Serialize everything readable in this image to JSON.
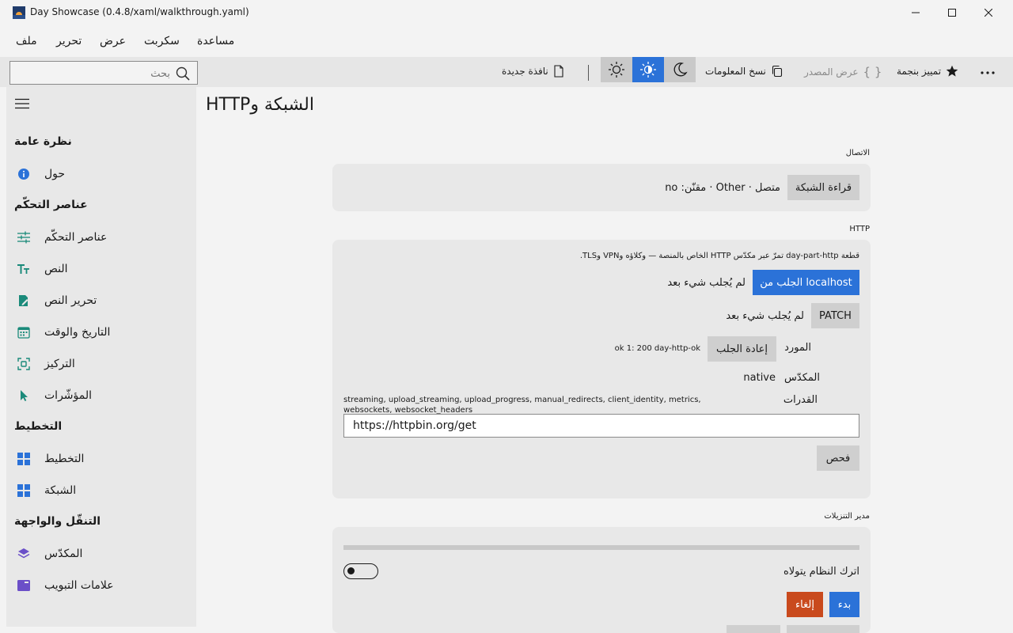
{
  "window": {
    "title": "Day Showcase (0.4.8/xaml/walkthrough.yaml)"
  },
  "menu": {
    "items": [
      "ملف",
      "تحرير",
      "عرض",
      "سكربت",
      "مساعدة"
    ]
  },
  "toolbar": {
    "search_placeholder": "بحث",
    "new_window": "نافذة جديدة",
    "copy_info": "نسخ المعلومات",
    "view_source": "عرض المصدر",
    "star": "تمييز بنجمة"
  },
  "sidebar": {
    "sections": [
      {
        "title": "نظرة عامة",
        "items": [
          "حول"
        ]
      },
      {
        "title": "عناصر التحكّم",
        "items": [
          "عناصر التحكّم",
          "النص",
          "تحرير النص",
          "التاريخ والوقت",
          "التركيز",
          "المؤشّرات"
        ]
      },
      {
        "title": "التخطيط",
        "items": [
          "التخطيط",
          "الشبكة"
        ]
      },
      {
        "title": "التنقّل والواجهة",
        "items": [
          "المكدّس",
          "علامات التبويب"
        ]
      }
    ]
  },
  "page": {
    "title": "الشبكة وHTTP",
    "connection": {
      "label": "الاتصال",
      "read_button": "قراءة الشبكة",
      "status": "متصل · Other · مقنّن: no"
    },
    "http": {
      "label": "HTTP",
      "description": "قطعة day-part-http تمرّ عبر مكدّس HTTP الخاص بالمنصة — وكلاؤه وVPN وTLS.",
      "fetch_localhost_button": "الجلب من localhost",
      "fetch_localhost_status": "لم يُجلب شيء بعد",
      "patch_button": "PATCH",
      "patch_status": "لم يُجلب شيء بعد",
      "resource_label": "المورد",
      "refetch_button": "إعادة الجلب",
      "resource_value": "ok 1: 200 day-http-ok",
      "stack_label": "المكدّس",
      "stack_value": "native",
      "capabilities_label": "القدرات",
      "capabilities_value": "streaming, upload_streaming, upload_progress, manual_redirects, client_identity, metrics, websockets, websocket_headers",
      "url_value": "https://httpbin.org/get",
      "check_button": "فحص"
    },
    "downloads": {
      "label": "مدير التنزيلات",
      "progress": 0,
      "system_handles_label": "اترك النظام يتولاه",
      "toggle_on": false,
      "start_button": "بدء",
      "cancel_button": "إلغاء"
    }
  },
  "colors": {
    "accent": "#2b72d8",
    "danger": "#c94a1d"
  }
}
